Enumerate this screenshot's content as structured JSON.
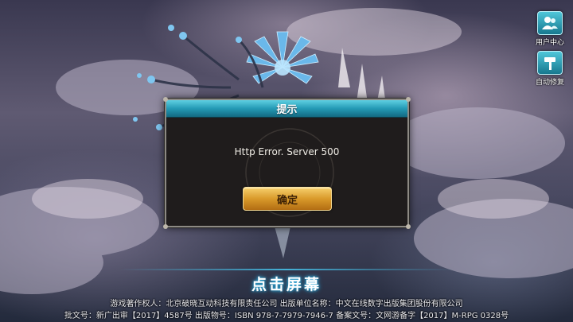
{
  "side_buttons": {
    "user_center": {
      "label": "用户中心",
      "icon": "users-icon"
    },
    "auto_repair": {
      "label": "自动修复",
      "icon": "hammer-icon"
    }
  },
  "dialog": {
    "title": "提示",
    "message": "Http Error. Server 500",
    "confirm_label": "确定"
  },
  "tap_prompt": "点击屏幕",
  "legal": {
    "line1": "游戏著作权人：北京破晓互动科技有限责任公司 出版单位名称：中文在线数字出版集团股份有限公司",
    "line2": "批文号：新广出审【2017】4587号   出版物号：ISBN 978-7-7979-7946-7   备案文号：文网游备字【2017】M-RPG 0328号"
  },
  "colors": {
    "header_accent": "#249ab5",
    "button_gold": "#d99a2a",
    "side_button": "#17788f"
  }
}
